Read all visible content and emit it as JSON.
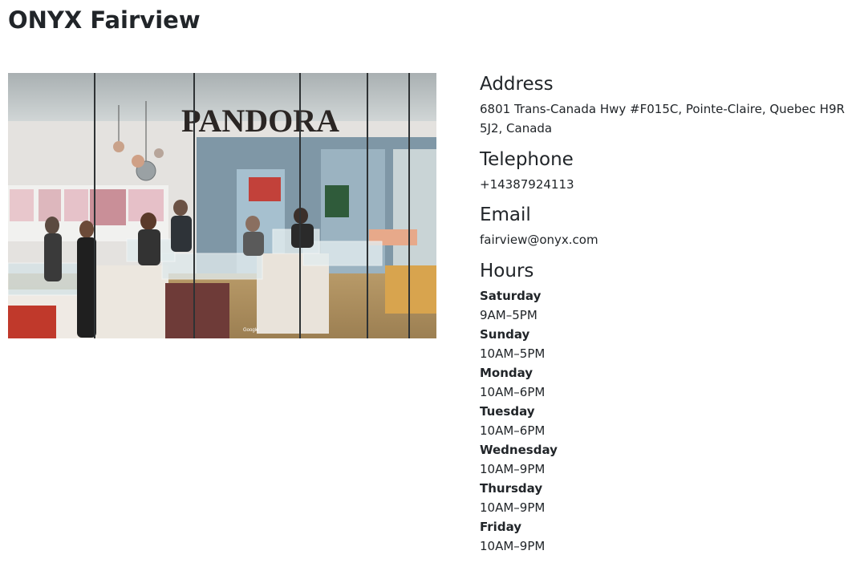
{
  "page": {
    "title": "ONYX Fairview"
  },
  "photo": {
    "storefront_sign": "PANDORA",
    "watermark": "Google"
  },
  "address": {
    "heading": "Address",
    "text": "6801 Trans-Canada Hwy #F015C, Pointe-Claire, Quebec H9R 5J2, Canada"
  },
  "telephone": {
    "heading": "Telephone",
    "text": "+14387924113"
  },
  "email": {
    "heading": "Email",
    "text": "fairview@onyx.com"
  },
  "hours": {
    "heading": "Hours",
    "days": [
      {
        "day": "Saturday",
        "time": "9AM–5PM"
      },
      {
        "day": "Sunday",
        "time": "10AM–5PM"
      },
      {
        "day": "Monday",
        "time": "10AM–6PM"
      },
      {
        "day": "Tuesday",
        "time": "10AM–6PM"
      },
      {
        "day": "Wednesday",
        "time": "10AM–9PM"
      },
      {
        "day": "Thursday",
        "time": "10AM–9PM"
      },
      {
        "day": "Friday",
        "time": "10AM–9PM"
      }
    ]
  }
}
